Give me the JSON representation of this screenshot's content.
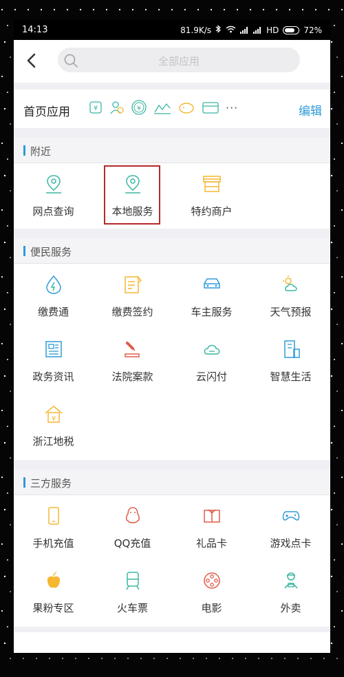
{
  "status_bar": {
    "time": "14:13",
    "net_speed": "81.9K/s",
    "hd": "HD",
    "battery": "72%"
  },
  "search": {
    "placeholder": "全部应用"
  },
  "home_apps": {
    "title": "首页应用",
    "edit_label": "编辑",
    "more": "···",
    "icons": [
      "transfer-icon",
      "users-icon",
      "yuan-icon",
      "chart-icon",
      "piggy-icon",
      "card-icon"
    ]
  },
  "sections": [
    {
      "title": "附近",
      "items": [
        {
          "label": "网点查询",
          "icon": "map-pin-icon"
        },
        {
          "label": "本地服务",
          "icon": "map-pin-icon"
        },
        {
          "label": "特约商户",
          "icon": "shop-icon"
        }
      ]
    },
    {
      "title": "便民服务",
      "items": [
        {
          "label": "缴费通",
          "icon": "drop-bolt-icon"
        },
        {
          "label": "缴费签约",
          "icon": "document-pen-icon"
        },
        {
          "label": "车主服务",
          "icon": "car-icon"
        },
        {
          "label": "天气预报",
          "icon": "weather-icon"
        },
        {
          "label": "政务资讯",
          "icon": "newspaper-icon"
        },
        {
          "label": "法院案款",
          "icon": "gavel-icon"
        },
        {
          "label": "云闪付",
          "icon": "cloud-icon"
        },
        {
          "label": "智慧生活",
          "icon": "building-icon"
        },
        {
          "label": "浙江地税",
          "icon": "house-yuan-icon"
        }
      ]
    },
    {
      "title": "三方服务",
      "items": [
        {
          "label": "手机充值",
          "icon": "phone-icon"
        },
        {
          "label": "QQ充值",
          "icon": "penguin-icon"
        },
        {
          "label": "礼品卡",
          "icon": "gift-card-icon"
        },
        {
          "label": "游戏点卡",
          "icon": "gamepad-icon"
        },
        {
          "label": "果粉专区",
          "icon": "apple-icon"
        },
        {
          "label": "火车票",
          "icon": "train-icon"
        },
        {
          "label": "电影",
          "icon": "film-reel-icon"
        },
        {
          "label": "外卖",
          "icon": "delivery-person-icon"
        }
      ]
    }
  ],
  "colors": {
    "accent": "#2e9bd7",
    "teal": "#3ab5a2",
    "orange": "#f5b731",
    "red": "#e25b4a",
    "highlight_border": "#b32a2a"
  }
}
